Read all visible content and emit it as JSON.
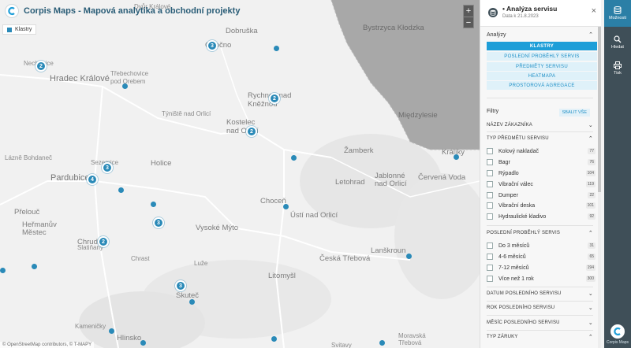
{
  "app": {
    "title": "Corpis Maps - Mapová analytika a obchodní projekty"
  },
  "legend": {
    "label": "Klastry"
  },
  "map": {
    "zoom_in": "+",
    "zoom_out": "−",
    "attribution": "© OpenStreetMap contributors, © T-MAPY",
    "towns": [
      {
        "name": "Hradec Králové",
        "cls": "big"
      },
      {
        "name": "Pardubice",
        "cls": "big"
      },
      {
        "name": "Chrudim",
        "cls": "med"
      },
      {
        "name": "Dobruška",
        "cls": "med"
      },
      {
        "name": "Rychnov nad Kněžnou",
        "cls": "med"
      },
      {
        "name": "Kostelec nad Orlicí",
        "cls": "med"
      },
      {
        "name": "Žamberk",
        "cls": "med"
      },
      {
        "name": "Ústí nad Orlicí",
        "cls": "med"
      },
      {
        "name": "Choceň",
        "cls": "med"
      },
      {
        "name": "Vysoké Mýto",
        "cls": "med"
      },
      {
        "name": "Litomyšl",
        "cls": "med"
      },
      {
        "name": "Česká Třebová",
        "cls": "med"
      },
      {
        "name": "Lanškroun",
        "cls": "med"
      },
      {
        "name": "Letohrad",
        "cls": "med"
      },
      {
        "name": "Holice",
        "cls": "med"
      },
      {
        "name": "Přelouč",
        "cls": "med"
      },
      {
        "name": "Heřmanův Městec",
        "cls": "med"
      },
      {
        "name": "Skuteč",
        "cls": "med"
      },
      {
        "name": "Hlinsko",
        "cls": "med"
      },
      {
        "name": "Králíky",
        "cls": "med"
      },
      {
        "name": "Jablonné nad Orlicí",
        "cls": "med"
      },
      {
        "name": "Červená Voda",
        "cls": "med"
      },
      {
        "name": "Bystrzyca Kłodzka",
        "cls": "med"
      },
      {
        "name": "Międzylesie",
        "cls": "med"
      },
      {
        "name": "Opočno",
        "cls": "med"
      },
      {
        "name": "Třebechovice pod Orebem",
        "cls": ""
      },
      {
        "name": "Týniště nad Orlicí",
        "cls": ""
      },
      {
        "name": "Sezemice",
        "cls": ""
      },
      {
        "name": "Nechanice",
        "cls": ""
      },
      {
        "name": "Lázně Bohdaneč",
        "cls": ""
      },
      {
        "name": "Slatiňany",
        "cls": ""
      },
      {
        "name": "Chrast",
        "cls": ""
      },
      {
        "name": "Luže",
        "cls": ""
      },
      {
        "name": "Svitavy",
        "cls": ""
      },
      {
        "name": "Moravská Třebová",
        "cls": ""
      },
      {
        "name": "Dvůr Králové",
        "cls": ""
      },
      {
        "name": "Kameničky",
        "cls": ""
      }
    ],
    "clusters": [
      "3",
      "2",
      "2",
      "2",
      "3",
      "4",
      "3",
      "2",
      "3"
    ]
  },
  "panel": {
    "title": "• Analýza servisu",
    "date": "Data k 21.8.2023",
    "close": "×",
    "analyzy_label": "Analýzy",
    "analyses": [
      {
        "label": "KLASTRY",
        "active": true
      },
      {
        "label": "POSLEDNÍ PROBĚHLÝ SERVIS",
        "active": false
      },
      {
        "label": "PŘEDMĚTY SERVISU",
        "active": false
      },
      {
        "label": "HEATMAPA",
        "active": false
      },
      {
        "label": "PROSTOROVÁ AGREGACE",
        "active": false
      }
    ],
    "filtry_label": "Filtry",
    "collapse_all": "SBALIT VŠE",
    "sec_zakaznik": "NÁZEV ZÁKAZNÍKA",
    "sec_typ": "TYP PŘEDMĚTU SERVISU",
    "typ_items": [
      {
        "label": "Kolový nakladač",
        "count": "77"
      },
      {
        "label": "Bagr",
        "count": "76"
      },
      {
        "label": "Rýpadlo",
        "count": "104"
      },
      {
        "label": "Vibrační válec",
        "count": "119"
      },
      {
        "label": "Dumper",
        "count": "22"
      },
      {
        "label": "Vibrační deska",
        "count": "101"
      },
      {
        "label": "Hydraulické kladivo",
        "count": "92"
      }
    ],
    "sec_posledni": "POSLEDNÍ PROBĚHLÝ SERVIS",
    "posledni_items": [
      {
        "label": "Do 3 měsíců",
        "count": "31"
      },
      {
        "label": "4-6 měsíců",
        "count": "65"
      },
      {
        "label": "7-12 měsíců",
        "count": "194"
      },
      {
        "label": "Více než 1 rok",
        "count": "300"
      }
    ],
    "sec_datum": "DATUM POSLEDNÍHO SERVISU",
    "sec_rok": "ROK POSLEDNÍHO SERVISU",
    "sec_mesic": "MĚSÍC POSLEDNÍHO SERVISU",
    "sec_zaruka": "TYP ZÁRUKY"
  },
  "toolbar": {
    "moznosti": "Možnosti",
    "hledat": "Hledat",
    "tisk": "Tisk",
    "brand": "Corpis Maps"
  }
}
